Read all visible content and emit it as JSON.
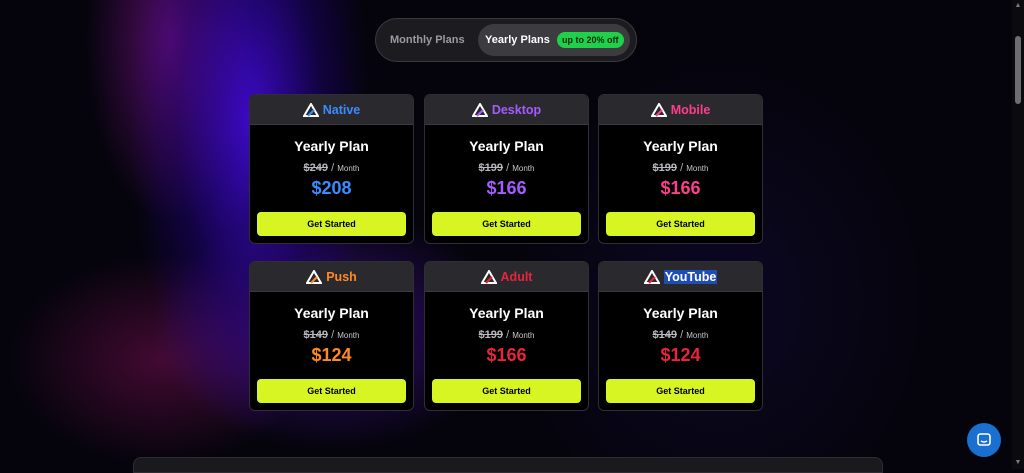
{
  "toggle": {
    "monthly_label": "Monthly Plans",
    "yearly_label": "Yearly Plans",
    "badge": "up to 20% off"
  },
  "cards": [
    {
      "name": "Native",
      "name_color": "#3b8bff",
      "plan": "Yearly Plan",
      "old_price": "$249",
      "separator": "/",
      "per": "Month",
      "price": "$208",
      "price_color": "#3b8bff",
      "cta": "Get Started",
      "icon": "logo-icon"
    },
    {
      "name": "Desktop",
      "name_color": "#a45bff",
      "plan": "Yearly Plan",
      "old_price": "$199",
      "separator": "/",
      "per": "Month",
      "price": "$166",
      "price_color": "#a45bff",
      "cta": "Get Started",
      "icon": "logo-icon"
    },
    {
      "name": "Mobile",
      "name_color": "#ff3d8f",
      "plan": "Yearly Plan",
      "old_price": "$199",
      "separator": "/",
      "per": "Month",
      "price": "$166",
      "price_color": "#ff3d8f",
      "cta": "Get Started",
      "icon": "logo-icon"
    },
    {
      "name": "Push",
      "name_color": "#ff8a25",
      "plan": "Yearly Plan",
      "old_price": "$149",
      "separator": "/",
      "per": "Month",
      "price": "$124",
      "price_color": "#ff8a25",
      "cta": "Get Started",
      "icon": "logo-icon"
    },
    {
      "name": "Adult",
      "name_color": "#e8243a",
      "plan": "Yearly Plan",
      "old_price": "$199",
      "separator": "/",
      "per": "Month",
      "price": "$166",
      "price_color": "#e8243a",
      "cta": "Get Started",
      "icon": "logo-icon"
    },
    {
      "name": "YouTube",
      "name_color": "#ffffff",
      "plan": "Yearly Plan",
      "old_price": "$149",
      "separator": "/",
      "per": "Month",
      "price": "$124",
      "price_color": "#e8243a",
      "cta": "Get Started",
      "icon": "logo-icon"
    }
  ],
  "colors": {
    "cta_bg": "#d7f523",
    "badge_bg": "#21d04a",
    "chat_bg": "#1a6fd1"
  }
}
